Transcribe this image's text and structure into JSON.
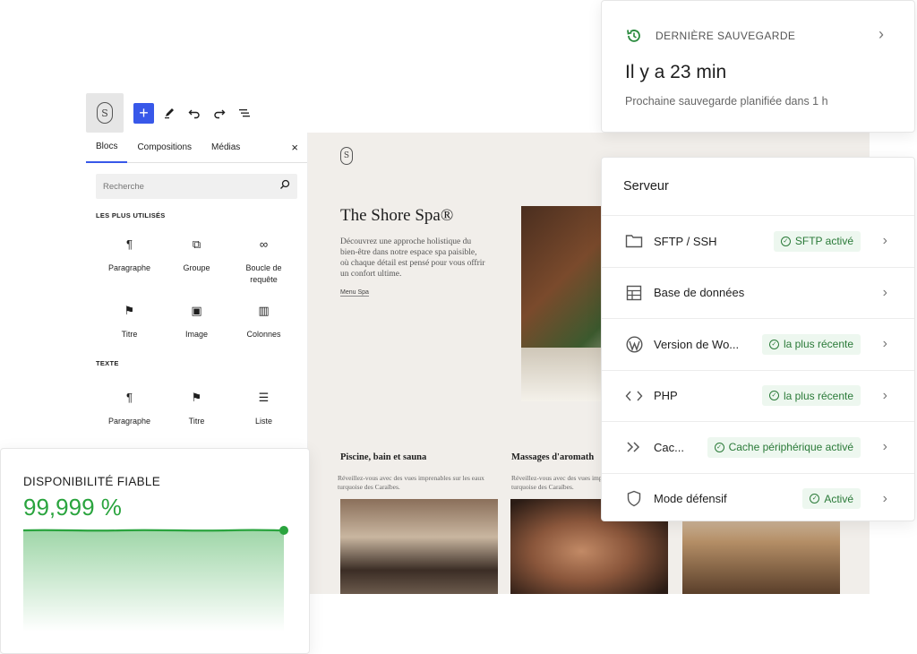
{
  "editor": {
    "toolbar": {
      "logo_letter": "S",
      "add_label": "+",
      "icons": [
        "pencil-icon",
        "undo-icon",
        "redo-icon",
        "list-view-icon"
      ]
    },
    "inserter": {
      "tabs": [
        "Blocs",
        "Compositions",
        "Médias"
      ],
      "active_tab": "Blocs",
      "close_label": "×",
      "search_placeholder": "Recherche",
      "sections": [
        {
          "label": "LES PLUS UTILISÉS",
          "blocks": [
            {
              "icon": "¶",
              "label": "Paragraphe"
            },
            {
              "icon": "⧉",
              "label": "Groupe"
            },
            {
              "icon": "∞",
              "label": "Boucle de requête"
            },
            {
              "icon": "⚑",
              "label": "Titre"
            },
            {
              "icon": "▣",
              "label": "Image"
            },
            {
              "icon": "▥",
              "label": "Colonnes"
            }
          ]
        },
        {
          "label": "TEXTE",
          "blocks": [
            {
              "icon": "¶",
              "label": "Paragraphe"
            },
            {
              "icon": "⚑",
              "label": "Titre"
            },
            {
              "icon": "☰",
              "label": "Liste"
            }
          ]
        }
      ]
    }
  },
  "site": {
    "logo_letter": "S",
    "title": "The Shore Spa®",
    "description": "Découvrez une approche holistique du bien-être dans notre espace spa paisible, où chaque détail est pensé pour vous offrir un confort ultime.",
    "link": "Menu Spa",
    "cards": [
      {
        "title": "Piscine, bain et sauna",
        "desc": "Réveillez-vous avec des vues imprenables sur les eaux turquoise des Caraïbes."
      },
      {
        "title": "Massages d'aromath",
        "desc": "Réveillez-vous avec des vues imprenables sur les eaux turquoise des Caraïbes."
      }
    ]
  },
  "backup": {
    "label": "DERNIÈRE SAUVEGARDE",
    "time": "Il y a 23 min",
    "next": "Prochaine sauvegarde planifiée dans 1 h",
    "accent": "#2a8a3e"
  },
  "server": {
    "title": "Serveur",
    "rows": [
      {
        "name": "SFTP / SSH",
        "icon": "folder-icon",
        "badge": "SFTP activé"
      },
      {
        "name": "Base de données",
        "icon": "table-icon",
        "badge": ""
      },
      {
        "name": "Version de Wo...",
        "icon": "wordpress-icon",
        "badge": "la plus récente"
      },
      {
        "name": "PHP",
        "icon": "code-icon",
        "badge": "la plus récente"
      },
      {
        "name": "Cac...",
        "icon": "double-chevron-icon",
        "badge": "Cache périphérique activé"
      },
      {
        "name": "Mode défensif",
        "icon": "shield-icon",
        "badge": "Activé"
      }
    ],
    "badge_color": "#2a7a38"
  },
  "uptime": {
    "label": "DISPONIBILITÉ FIABLE",
    "value": "99,999 %",
    "accent": "#2aa43e"
  }
}
